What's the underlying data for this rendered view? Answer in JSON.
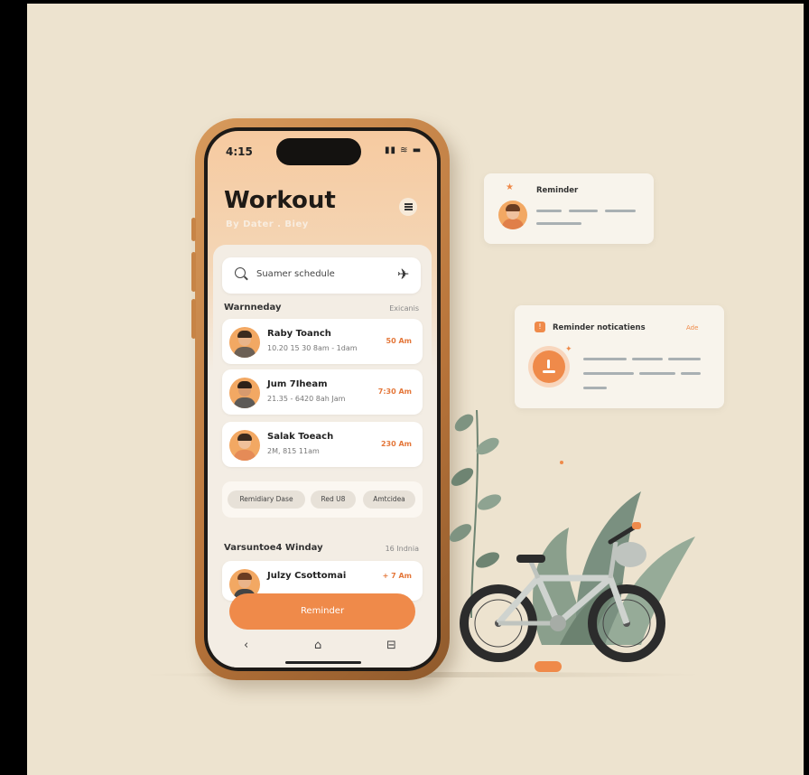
{
  "phone": {
    "time": "4:15",
    "status_icons": "▮▮ ≋ ▬",
    "title": "Workout",
    "subtitle": "By Dater . Biey",
    "search": {
      "placeholder": "Suamer schedule"
    },
    "sections": [
      {
        "label": "Warnneday",
        "right": "Exicanis"
      },
      {
        "label": "Varsuntoe4 Winday",
        "right": "16 Indnia"
      }
    ],
    "cards": [
      {
        "name": "Raby Toanch",
        "meta": "10.20 15 30 8am - 1dam",
        "time": "50 Am"
      },
      {
        "name": "Jum 7Iheam",
        "meta": "21.35 - 6420 8ah Jam",
        "time": "7:30 Am"
      },
      {
        "name": "Salak Toeach",
        "meta": "2M, 815 11am",
        "time": "230 Am"
      },
      {
        "name": "Julzy Csottomai",
        "meta": "",
        "time": "+ 7 Am"
      }
    ],
    "chips": [
      "Remidiary Dase",
      "Red U8",
      "Amtcidea"
    ],
    "cta": "Reminder",
    "nav": [
      "‹",
      "⌂",
      "⊟"
    ]
  },
  "reminder_card": {
    "title": "Reminder",
    "star": "★"
  },
  "notifications_card": {
    "title": "Reminder noticatiens",
    "right": "Ade"
  },
  "colors": {
    "accent": "#ef8a4a",
    "background": "#ede3cf",
    "phone_frame": "#c68547"
  }
}
